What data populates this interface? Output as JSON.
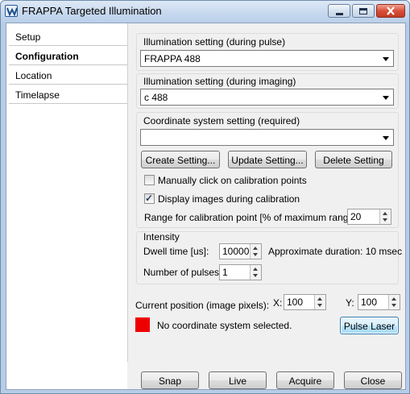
{
  "window": {
    "title": "FRAPPA Targeted Illumination",
    "controls": [
      "minimize",
      "maximize",
      "close"
    ]
  },
  "nav": {
    "items": [
      {
        "label": "Setup",
        "active": false
      },
      {
        "label": "Configuration",
        "active": true
      },
      {
        "label": "Location",
        "active": false
      },
      {
        "label": "Timelapse",
        "active": false
      }
    ]
  },
  "pulse_illumination": {
    "label": "Illumination setting (during pulse)",
    "value": "FRAPPA 488"
  },
  "imaging_illumination": {
    "label": "Illumination setting (during imaging)",
    "value": "c 488"
  },
  "coordinate_system": {
    "label": "Coordinate system setting (required)",
    "value": "",
    "create_label": "Create Setting...",
    "update_label": "Update Setting...",
    "delete_label": "Delete Setting",
    "manual_click_label": "Manually click on calibration points",
    "manual_click_checked": false,
    "display_images_label": "Display images during calibration",
    "display_images_checked": true,
    "range_label": "Range for calibration point [% of maximum range]:",
    "range_value": "20"
  },
  "intensity": {
    "label": "Intensity",
    "dwell_label": "Dwell time [us]:",
    "dwell_value": "10000",
    "approx_label": "Approximate duration: 10 msec",
    "pulses_label": "Number of pulses:",
    "pulses_value": "1"
  },
  "position": {
    "label": "Current position (image pixels):",
    "x_label": "X:",
    "x_value": "100",
    "y_label": "Y:",
    "y_value": "100"
  },
  "status": {
    "color": "#ee0000",
    "text": "No coordinate system selected.",
    "pulse_label": "Pulse Laser"
  },
  "footer": {
    "snap_label": "Snap",
    "live_label": "Live",
    "acquire_label": "Acquire",
    "close_label": "Close"
  }
}
